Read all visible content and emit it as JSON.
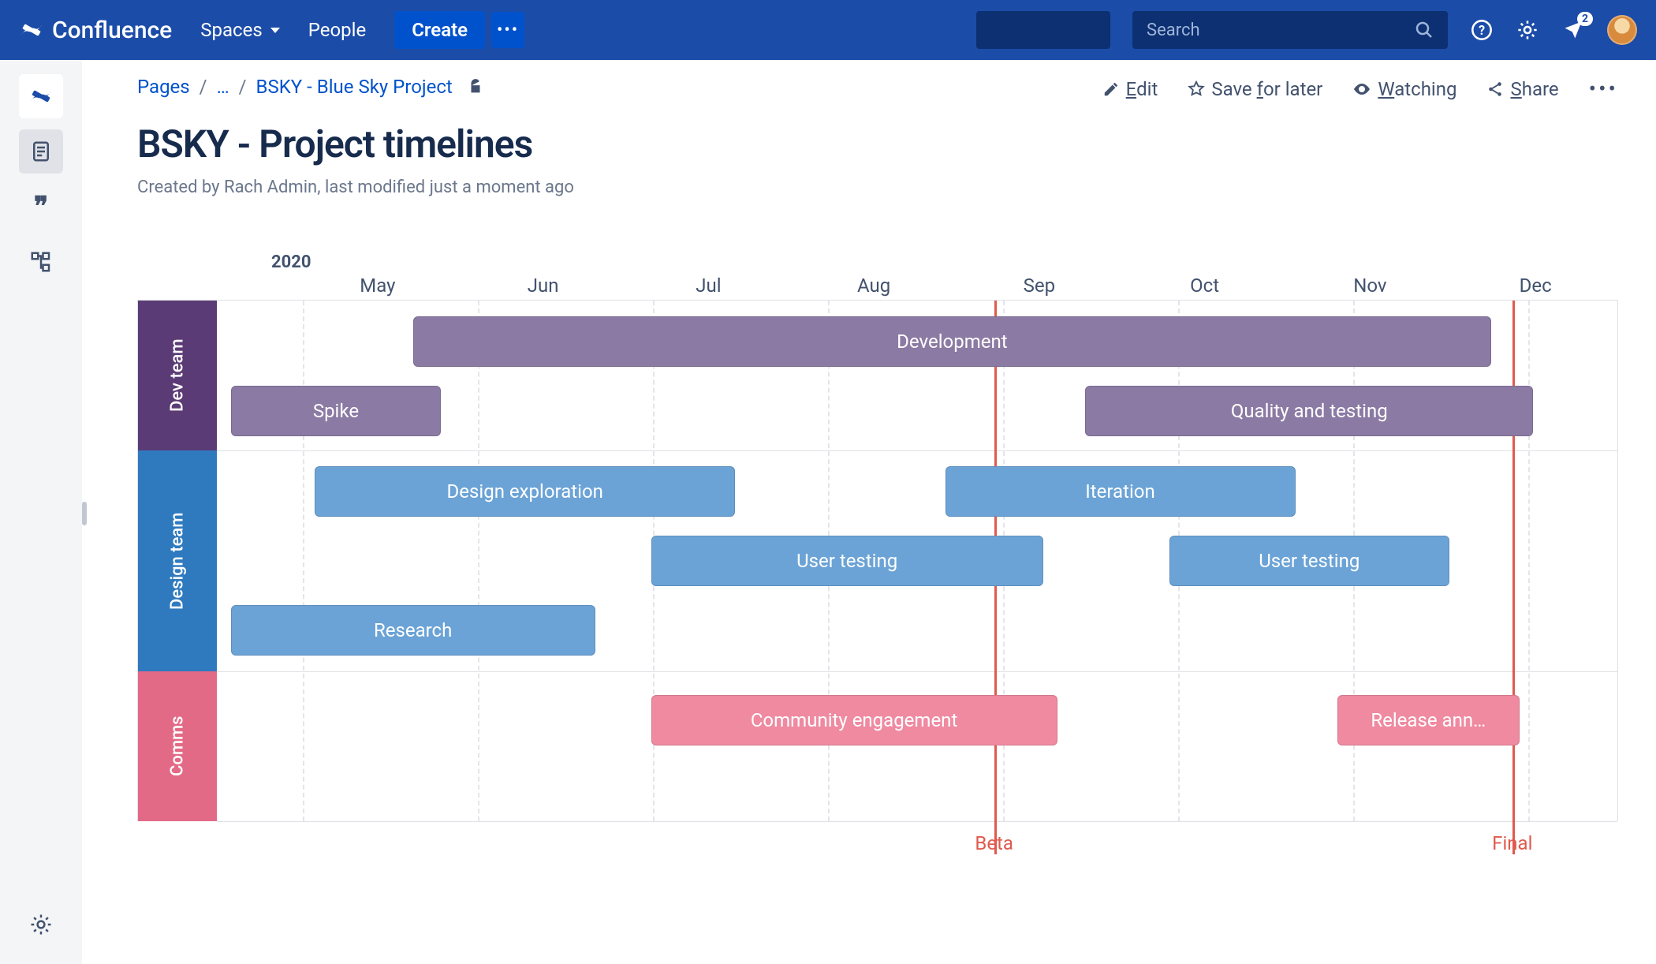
{
  "nav": {
    "brand": "Confluence",
    "spaces": "Spaces",
    "people": "People",
    "create": "Create",
    "search_placeholder": "Search",
    "notification_count": "2"
  },
  "breadcrumb": {
    "pages": "Pages",
    "ellipsis": "…",
    "project": "BSKY - Blue Sky Project"
  },
  "actions": {
    "edit": "Edit",
    "save": "Save for later",
    "watching": "Watching",
    "share": "Share"
  },
  "page": {
    "title": "BSKY - Project timelines",
    "meta": "Created by Rach Admin, last modified just a moment ago"
  },
  "chart_data": {
    "type": "gantt",
    "year": "2020",
    "months": [
      "May",
      "Jun",
      "Jul",
      "Aug",
      "Sep",
      "Oct",
      "Nov",
      "Dec"
    ],
    "lanes": [
      {
        "name": "Dev team",
        "color": "#5b3b76"
      },
      {
        "name": "Design team",
        "color": "#2f7abf"
      },
      {
        "name": "Comms",
        "color": "#e36a87"
      }
    ],
    "bars": [
      {
        "lane": "Dev team",
        "row": 0,
        "label": "Development",
        "start": "mid-May",
        "end": "mid-Nov",
        "startPct": 14,
        "widthPct": 77,
        "color": "purple"
      },
      {
        "lane": "Dev team",
        "row": 1,
        "label": "Spike",
        "start": "early-May",
        "end": "late-May",
        "startPct": 1,
        "widthPct": 15,
        "color": "purple"
      },
      {
        "lane": "Dev team",
        "row": 1,
        "label": "Quality and testing",
        "start": "mid-Sep",
        "end": "late-Nov",
        "startPct": 62,
        "widthPct": 32,
        "color": "purple"
      },
      {
        "lane": "Design team",
        "row": 0,
        "label": "Design exploration",
        "start": "early-May",
        "end": "mid-Jul",
        "startPct": 7,
        "widthPct": 30,
        "color": "blue"
      },
      {
        "lane": "Design team",
        "row": 0,
        "label": "Iteration",
        "start": "late-Aug",
        "end": "mid-Oct",
        "startPct": 52,
        "widthPct": 25,
        "color": "blue"
      },
      {
        "lane": "Design team",
        "row": 1,
        "label": "User testing",
        "start": "early-Jul",
        "end": "mid-Sep",
        "startPct": 31,
        "widthPct": 28,
        "color": "blue"
      },
      {
        "lane": "Design team",
        "row": 1,
        "label": "User testing",
        "start": "early-Oct",
        "end": "mid-Nov",
        "startPct": 68,
        "widthPct": 20,
        "color": "blue"
      },
      {
        "lane": "Design team",
        "row": 2,
        "label": "Research",
        "start": "early-May",
        "end": "late-Jun",
        "startPct": 1,
        "widthPct": 26,
        "color": "blue"
      },
      {
        "lane": "Comms",
        "row": 0,
        "label": "Community engagement",
        "start": "early-Jul",
        "end": "mid-Sep",
        "startPct": 31,
        "widthPct": 29,
        "color": "pink"
      },
      {
        "lane": "Comms",
        "row": 0,
        "label": "Release ann…",
        "start": "late-Oct",
        "end": "late-Nov",
        "startPct": 80,
        "widthPct": 13,
        "color": "pink"
      }
    ],
    "milestones": [
      {
        "label": "Beta",
        "position": "early-Sep",
        "pct": 55.5
      },
      {
        "label": "Final",
        "position": "mid-Nov",
        "pct": 92.5
      }
    ]
  }
}
